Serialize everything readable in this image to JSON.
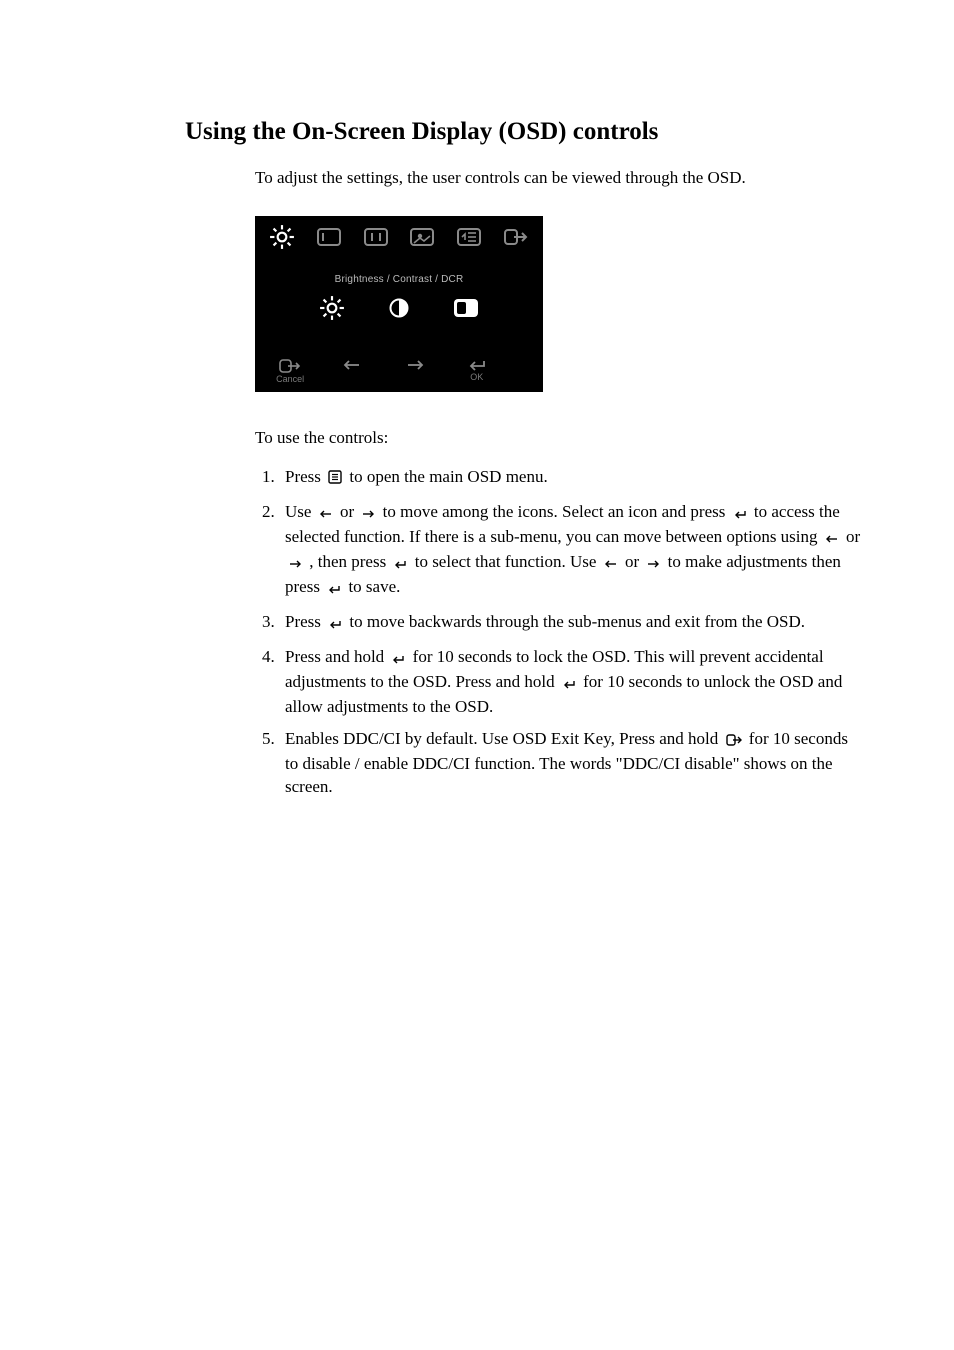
{
  "heading": "Using the On-Screen Display (OSD) controls",
  "intro": "To adjust the settings, the user controls can be viewed through the OSD.",
  "osd": {
    "section_title": "Brightness / Contrast / DCR",
    "footer": {
      "cancel": "Cancel",
      "ok": "OK"
    }
  },
  "sub_intro": "To use the controls:",
  "steps": {
    "s1a": "Press ",
    "s1b": " to open the main OSD menu.",
    "s2a": "Use ",
    "s2b": " or ",
    "s2c": " to move among the icons. Select an icon and press ",
    "s2d": " to access the selected function. If there is a sub-menu, you can move between options using ",
    "s2e": " or ",
    "s2f": ",   then press ",
    "s2g": " to select that function. Use ",
    "s2h": " or ",
    "s2i": " to make adjustments then press ",
    "s2j": "  to save.",
    "s3a": "Press ",
    "s3b": " to move backwards through the sub-menus and exit from the OSD.",
    "s4a": "Press and hold ",
    "s4b": "  for 10 seconds to lock the OSD. This will prevent accidental adjustments to the OSD. Press and hold ",
    "s4c": "  for 10 seconds to unlock the OSD and allow adjustments to the OSD.",
    "s5a": "Enables DDC/CI by default. Use OSD Exit Key,   Press and hold ",
    "s5b": " for 10 seconds to disable / enable DDC/CI function. The words \"DDC/CI disable\" shows on the screen."
  }
}
